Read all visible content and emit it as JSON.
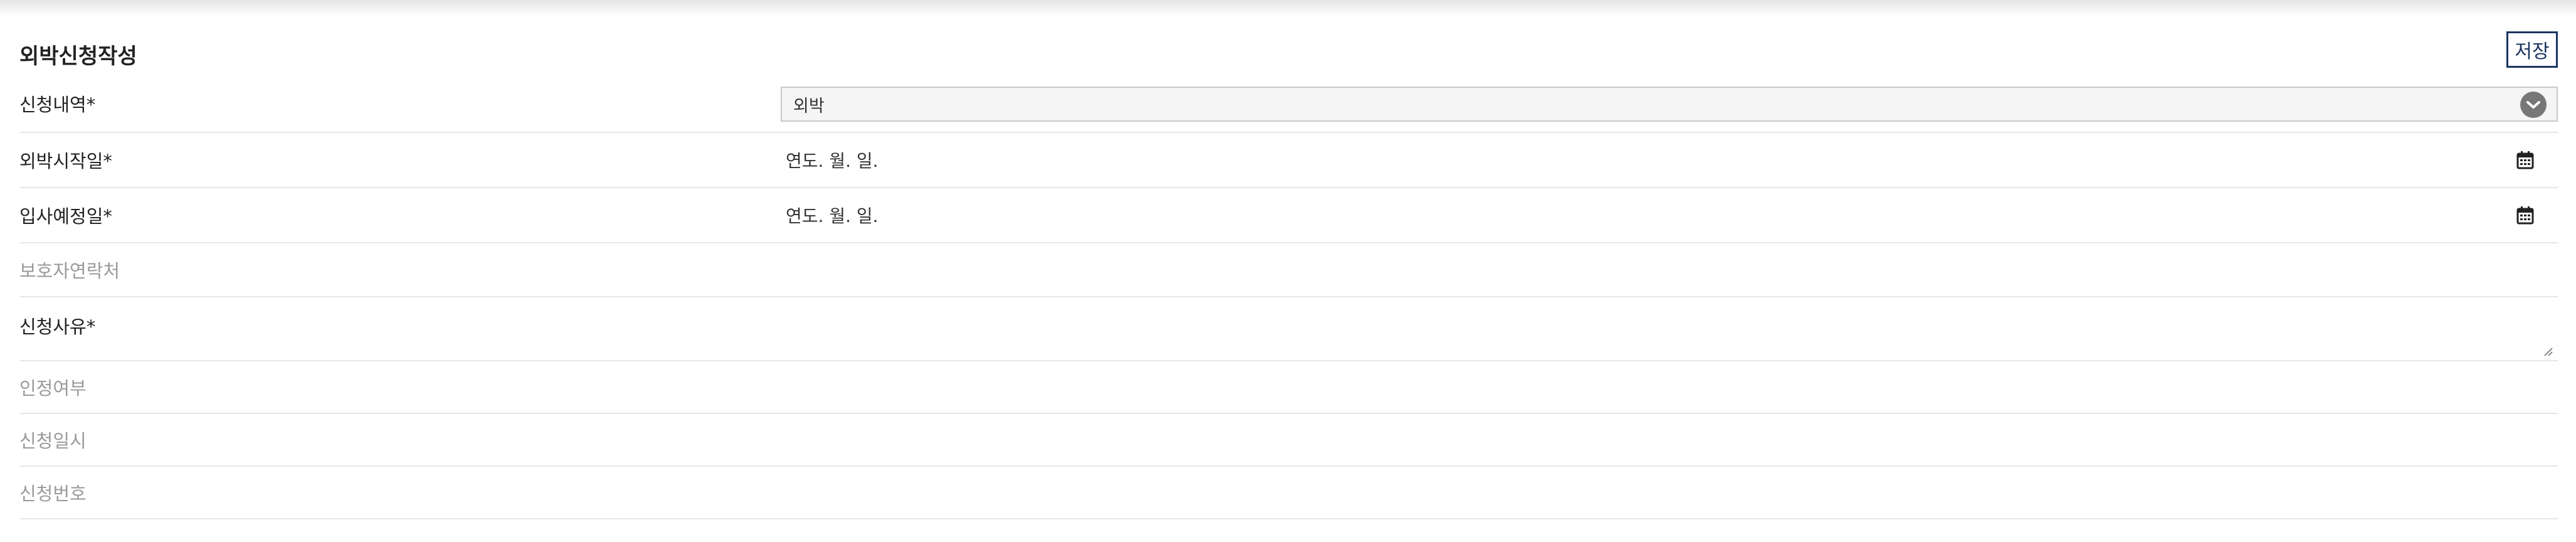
{
  "form": {
    "title": "외박신청작성",
    "save_label": "저장"
  },
  "fields": {
    "request_type": {
      "label": "신청내역*",
      "selected": "외박"
    },
    "start_date": {
      "label": "외박시작일*",
      "value": "연도. 월. 일."
    },
    "return_date": {
      "label": "입사예정일*",
      "value": "연도. 월. 일."
    },
    "guardian_contact": {
      "label": "보호자연락처"
    },
    "reason": {
      "label": "신청사유*"
    },
    "approval": {
      "label": "인정여부"
    },
    "request_datetime": {
      "label": "신청일시"
    },
    "request_number": {
      "label": "신청번호"
    }
  },
  "icons": {
    "select": "chevron-down-icon",
    "date": "calendar-icon",
    "textarea": "resize-handle-icon"
  },
  "colors": {
    "accent": "#1b3360",
    "muted_label": "#9a9a9a",
    "divider": "#e6e6e6"
  }
}
